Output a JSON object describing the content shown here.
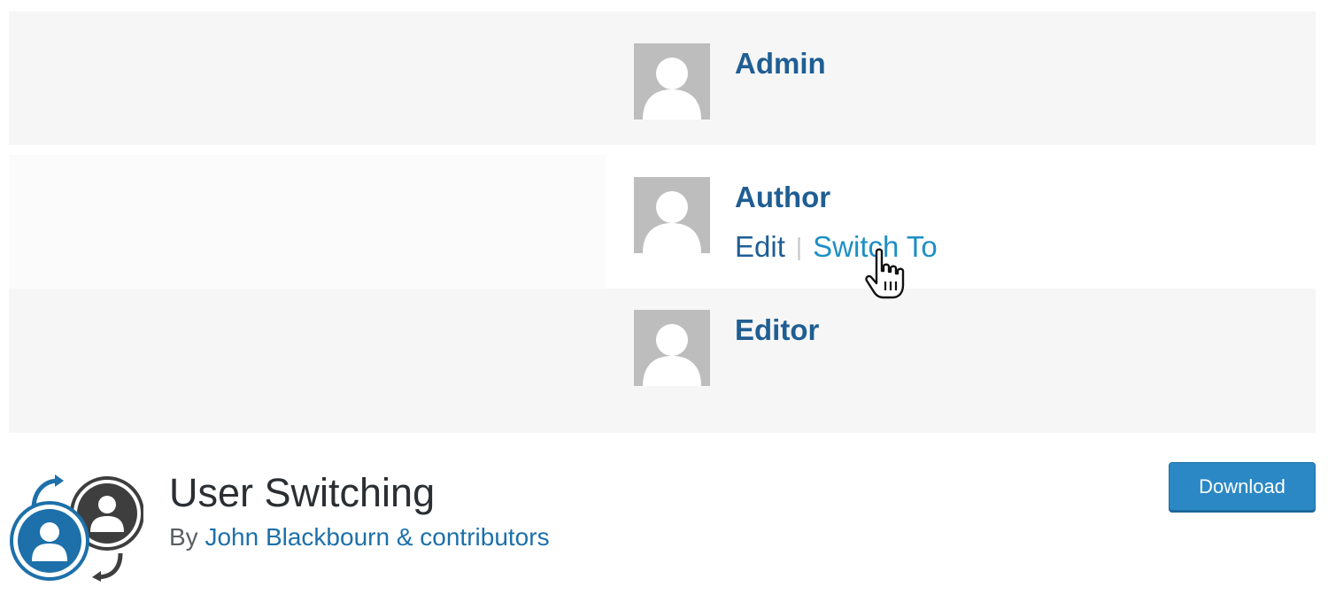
{
  "users": [
    {
      "role": "Admin",
      "actions": null
    },
    {
      "role": "Author",
      "actions": {
        "edit": "Edit",
        "separator": "|",
        "switch": "Switch To"
      }
    },
    {
      "role": "Editor",
      "actions": null
    }
  ],
  "plugin": {
    "title": "User Switching",
    "by_prefix": "By",
    "author": "John Blackbourn & contributors",
    "download_label": "Download"
  },
  "colors": {
    "role_text": "#1f5e93",
    "switch_link": "#1d8fc4",
    "download_button": "#2b88c5",
    "avatar_bg": "#bdbdbd",
    "icon_blue": "#1d70aa",
    "icon_dark": "#3e3e3e"
  },
  "icons": {
    "avatar": "default-user-silhouette-icon",
    "cursor": "hand-pointer-icon",
    "plugin": "user-switching-icon"
  }
}
